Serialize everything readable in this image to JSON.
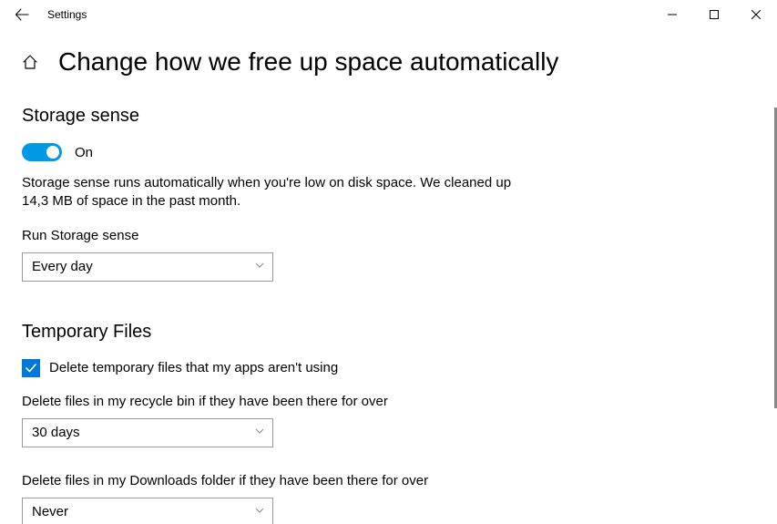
{
  "window": {
    "title": "Settings"
  },
  "header": {
    "page_title": "Change how we free up space automatically"
  },
  "storage_sense": {
    "heading": "Storage sense",
    "toggle_state": "On",
    "info": "Storage sense runs automatically when you're low on disk space. We cleaned up 14,3 MB of space in the past month.",
    "run_label": "Run Storage sense",
    "run_value": "Every day"
  },
  "temp_files": {
    "heading": "Temporary Files",
    "delete_temp_label": "Delete temporary files that my apps aren't using",
    "recycle_label": "Delete files in my recycle bin if they have been there for over",
    "recycle_value": "30 days",
    "downloads_label": "Delete files in my Downloads folder if they have been there for over",
    "downloads_value": "Never"
  }
}
